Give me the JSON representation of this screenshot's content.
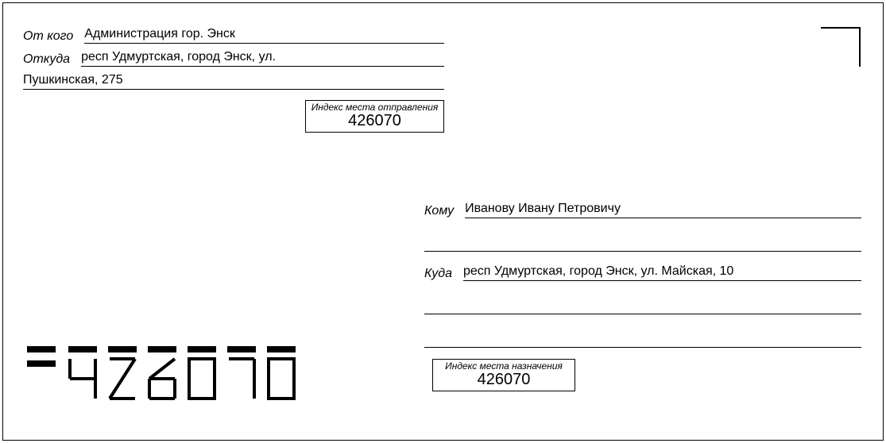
{
  "sender": {
    "from_label": "От кого",
    "from_value": "Администрация гор. Энск",
    "addr_label": "Откуда",
    "addr_value": "респ Удмуртская, город Энск, ул.",
    "addr_cont": "Пушкинская, 275",
    "idx_caption": "Индекс места отправления",
    "idx_value": "426070"
  },
  "recipient": {
    "to_label": "Кому",
    "to_value": "Иванову Ивану Петровичу",
    "addr_label": "Куда",
    "addr_value": "респ Удмуртская, город Энск, ул. Майская, 10",
    "idx_caption": "Индекс места назначения",
    "idx_value": "426070"
  },
  "postal_code_digits": [
    "4",
    "2",
    "6",
    "0",
    "7",
    "0"
  ]
}
